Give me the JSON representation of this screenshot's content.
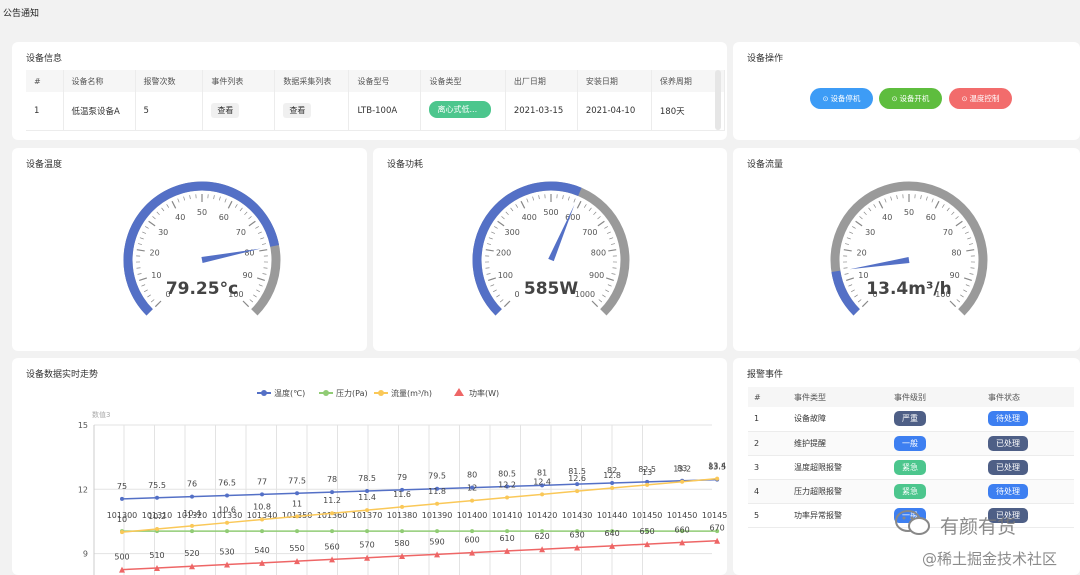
{
  "topbar": {
    "title": "公告通知"
  },
  "device_info": {
    "title": "设备信息",
    "columns": [
      "#",
      "设备名称",
      "报警次数",
      "事件列表",
      "数据采集列表",
      "设备型号",
      "设备类型",
      "出厂日期",
      "安装日期",
      "保养周期"
    ],
    "row": {
      "index": "1",
      "name": "低温泵设备A",
      "alarms": "5",
      "events_btn": "查看",
      "data_btn": "查看",
      "model": "LTB-100A",
      "type": "离心式低...",
      "factory_date": "2021-03-15",
      "install_date": "2021-04-10",
      "maintenance": "180天"
    }
  },
  "device_ops": {
    "title": "设备操作",
    "buttons": [
      {
        "label": "设备停机",
        "color": "#3d9cf6",
        "icon": "power-icon"
      },
      {
        "label": "设备开机",
        "color": "#5ebd3e",
        "icon": "play-icon"
      },
      {
        "label": "温度控制",
        "color": "#f26c6c",
        "icon": "thermometer-icon"
      }
    ]
  },
  "gauges": [
    {
      "title": "设备温度",
      "value": 79.25,
      "display": "79.25°c",
      "max": 100,
      "ticks": [
        "0",
        "10",
        "20",
        "30",
        "40",
        "50",
        "60",
        "70",
        "80",
        "90",
        "100"
      ]
    },
    {
      "title": "设备功耗",
      "value": 585,
      "display": "585W",
      "max": 1000,
      "ticks": [
        "0",
        "100",
        "200",
        "300",
        "400",
        "500",
        "600",
        "700",
        "800",
        "900",
        "1000"
      ]
    },
    {
      "title": "设备流量",
      "value": 13.4,
      "display": "13.4m³/h",
      "max": 100,
      "ticks": [
        "0",
        "10",
        "20",
        "30",
        "40",
        "50",
        "60",
        "70",
        "80",
        "90",
        "100"
      ]
    }
  ],
  "trend": {
    "title": "设备数据实时走势",
    "y_axis_name": "数值3",
    "chart_data": {
      "type": "line",
      "ylim": [
        8,
        15
      ],
      "yticks": [
        "15",
        "12",
        "9"
      ],
      "series": [
        {
          "name": "温度(℃)",
          "color": "#5470c6",
          "values": [
            75,
            75.5,
            76,
            76.5,
            77,
            77.5,
            78,
            78.5,
            79,
            79.5,
            80,
            80.5,
            81,
            81.5,
            82,
            82.5,
            83,
            83.5
          ],
          "labels": [
            "75",
            "75.5",
            "76",
            "76.5",
            "77",
            "77.5",
            "78",
            "78.5",
            "79",
            "79.5",
            "80",
            "80.5",
            "81",
            "81.5",
            "82",
            "82.5",
            "83",
            "83.5"
          ]
        },
        {
          "name": "压力(Pa)",
          "color": "#91cc75",
          "values": [
            101300,
            101310,
            101320,
            101330,
            101340,
            101350,
            101360,
            101370,
            101380,
            101390,
            101400,
            101410,
            101420,
            101430,
            101440,
            101450,
            101450,
            101450
          ],
          "labels": [
            "101300",
            "101310",
            "101320",
            "101330",
            "101340",
            "101350",
            "101360",
            "101370",
            "101380",
            "101390",
            "101400",
            "101410",
            "101420",
            "101430",
            "101440",
            "101450",
            "101450",
            "101450"
          ]
        },
        {
          "name": "流量(m³/h)",
          "color": "#fac858",
          "values": [
            10,
            10.2,
            10.4,
            10.6,
            10.8,
            11,
            11.2,
            11.4,
            11.6,
            11.8,
            12,
            12.2,
            12.4,
            12.6,
            12.8,
            13,
            13.2,
            13.4
          ],
          "labels": [
            "10",
            "10.2",
            "10.4",
            "10.6",
            "10.8",
            "11",
            "11.2",
            "11.4",
            "11.6",
            "11.8",
            "12",
            "12.2",
            "12.4",
            "12.6",
            "12.8",
            "13",
            "13.2",
            "13.4"
          ]
        },
        {
          "name": "功率(W)",
          "color": "#ee6666",
          "values": [
            500,
            510,
            520,
            530,
            540,
            550,
            560,
            570,
            580,
            590,
            600,
            610,
            620,
            630,
            640,
            650,
            660,
            670
          ],
          "labels": [
            "500",
            "510",
            "520",
            "530",
            "540",
            "550",
            "560",
            "570",
            "580",
            "590",
            "600",
            "610",
            "620",
            "630",
            "640",
            "650",
            "660",
            "670"
          ]
        }
      ]
    }
  },
  "alarms": {
    "title": "报警事件",
    "columns": [
      "#",
      "事件类型",
      "事件级别",
      "事件状态"
    ],
    "rows": [
      {
        "index": "1",
        "type": "设备故障",
        "level": "严重",
        "level_color": "#4e5f86",
        "status": "待处理",
        "status_color": "#3d7ff1"
      },
      {
        "index": "2",
        "type": "维护提醒",
        "level": "一般",
        "level_color": "#3d7ff1",
        "status": "已处理",
        "status_color": "#4e5f86"
      },
      {
        "index": "3",
        "type": "温度超限报警",
        "level": "紧急",
        "level_color": "#4cc68d",
        "status": "已处理",
        "status_color": "#4e5f86"
      },
      {
        "index": "4",
        "type": "压力超限报警",
        "level": "紧急",
        "level_color": "#4cc68d",
        "status": "待处理",
        "status_color": "#3d7ff1"
      },
      {
        "index": "5",
        "type": "功率异常报警",
        "level": "一般",
        "level_color": "#3d7ff1",
        "status": "已处理",
        "status_color": "#4e5f86"
      }
    ]
  },
  "watermark": {
    "line1": "有颜有货",
    "line2": "@稀土掘金技术社区"
  }
}
